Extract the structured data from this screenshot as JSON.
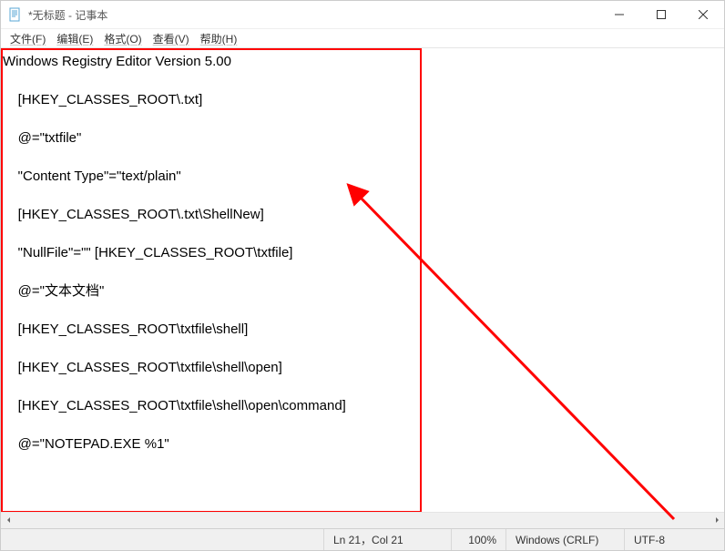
{
  "titlebar": {
    "title": "*无标题 - 记事本"
  },
  "menu": {
    "file": "文件(F)",
    "edit": "编辑(E)",
    "format": "格式(O)",
    "view": "查看(V)",
    "help": "帮助(H)"
  },
  "editor": {
    "content": "Windows Registry Editor Version 5.00\n\n    [HKEY_CLASSES_ROOT\\.txt]\n\n    @=\"txtfile\"\n\n    \"Content Type\"=\"text/plain\"\n\n    [HKEY_CLASSES_ROOT\\.txt\\ShellNew]\n\n    \"NullFile\"=\"\" [HKEY_CLASSES_ROOT\\txtfile]\n\n    @=\"文本文档\"\n\n    [HKEY_CLASSES_ROOT\\txtfile\\shell]\n\n    [HKEY_CLASSES_ROOT\\txtfile\\shell\\open]\n\n    [HKEY_CLASSES_ROOT\\txtfile\\shell\\open\\command]\n\n    @=\"NOTEPAD.EXE %1\""
  },
  "statusbar": {
    "position": "Ln 21，Col 21",
    "zoom": "100%",
    "lineEnding": "Windows (CRLF)",
    "encoding": "UTF-8"
  }
}
